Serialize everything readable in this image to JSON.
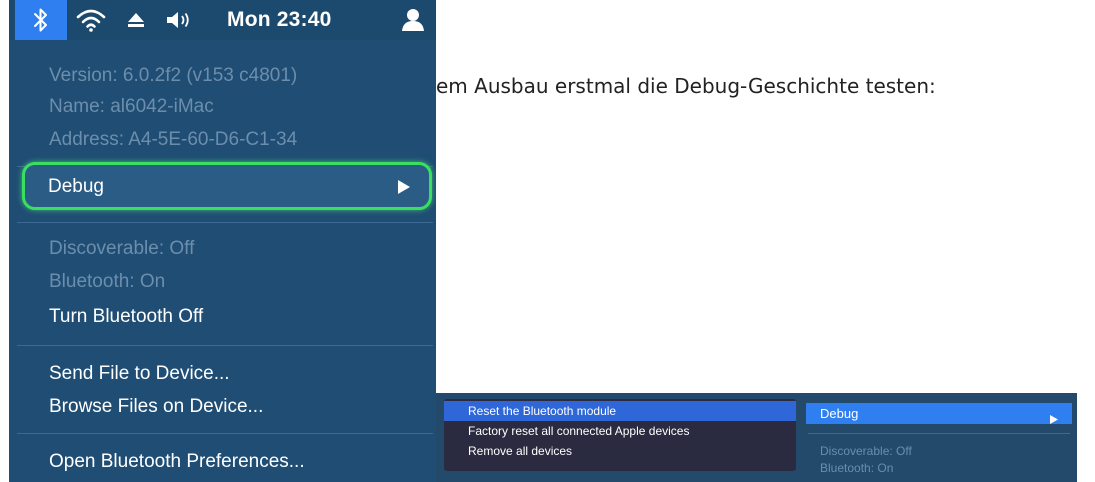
{
  "menubar": {
    "clock": "Mon 23:40",
    "icons": [
      "bluetooth-icon",
      "wifi-icon",
      "eject-icon",
      "volume-icon",
      "user-icon"
    ],
    "bluetooth_highlight_color": "#2f7ff0"
  },
  "bt_menu": {
    "version": "Version: 6.0.2f2 (v153 c4801)",
    "name": "Name: al6042-iMac",
    "address": "Address: A4-5E-60-D6-C1-34",
    "debug": "Debug",
    "discoverable": "Discoverable: Off",
    "bluetooth_status": "Bluetooth: On",
    "turn_off": "Turn Bluetooth Off",
    "send_file": "Send File to Device...",
    "browse_files": "Browse Files on Device...",
    "open_prefs": "Open Bluetooth Preferences...",
    "debug_outline_color": "#39e05f"
  },
  "body_text": "em Ausbau erstmal die Debug-Geschichte testen:",
  "submenu": {
    "items": [
      "Reset the Bluetooth module",
      "Factory reset all connected Apple devices",
      "Remove all devices"
    ],
    "debug": "Debug",
    "discoverable": "Discoverable: Off",
    "bluetooth_status": "Bluetooth: On"
  }
}
